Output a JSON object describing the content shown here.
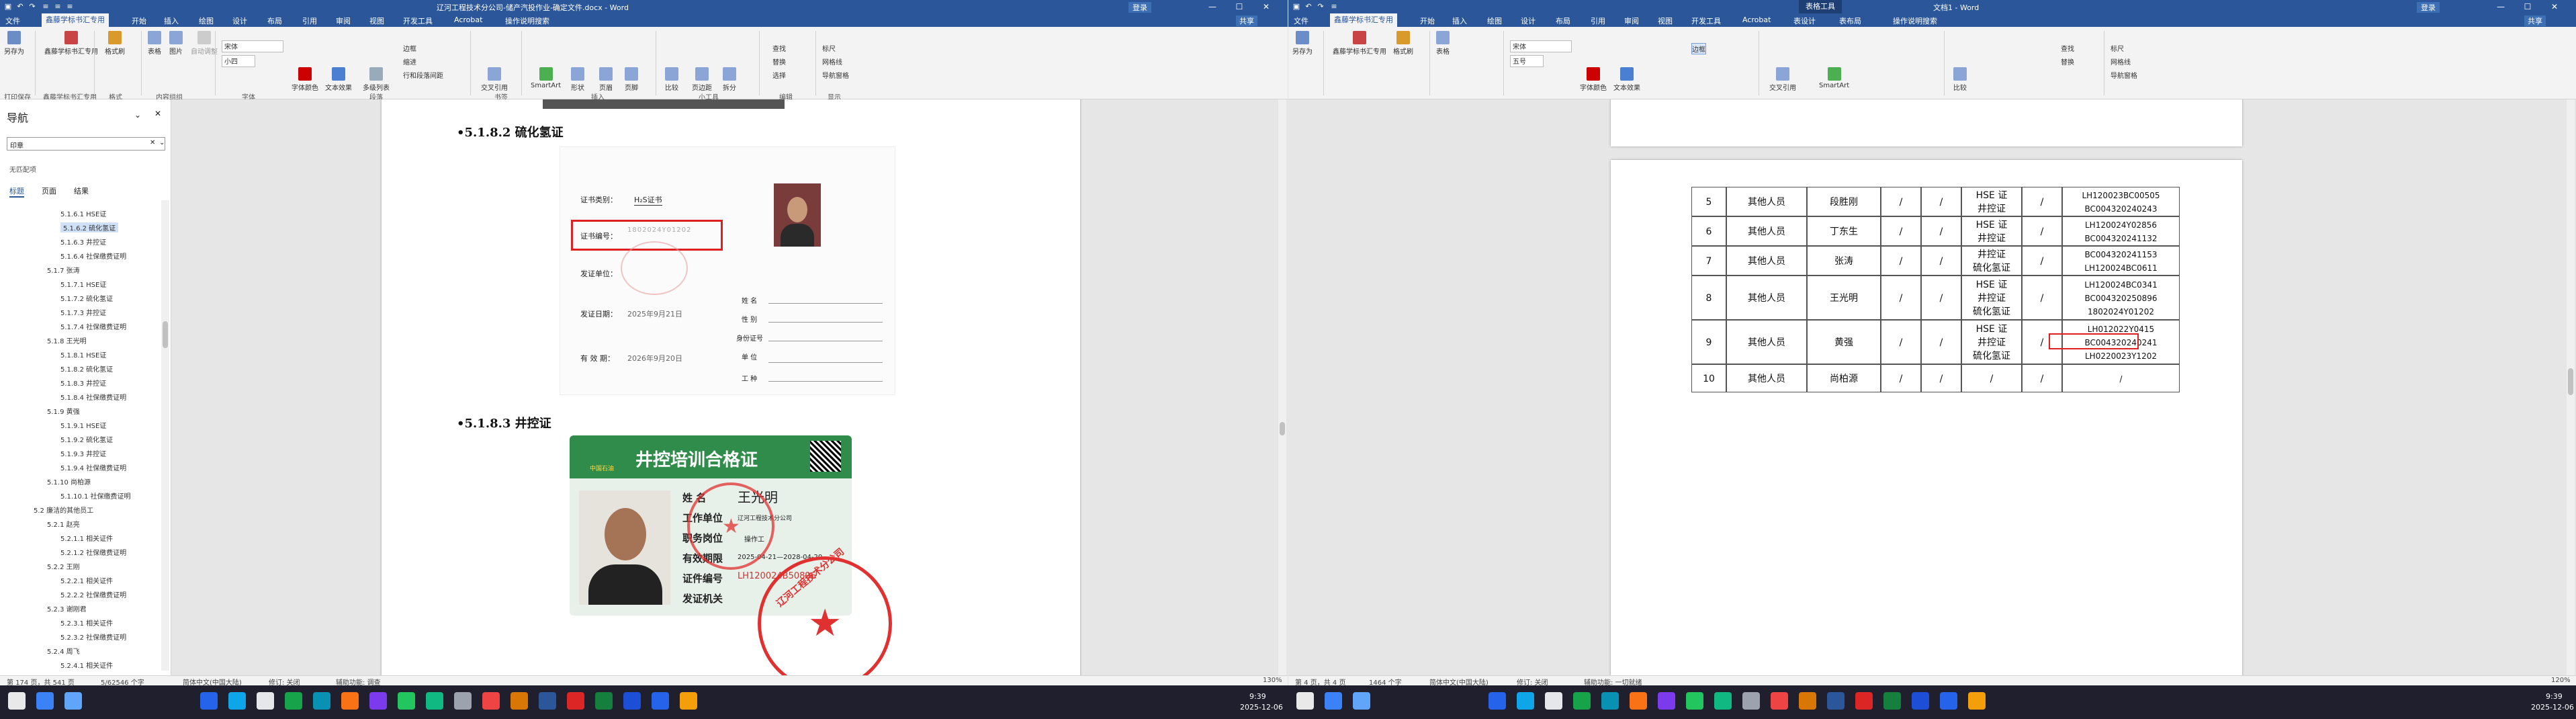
{
  "left": {
    "title": "辽河工程技术分公司-储产汽投作业-确定文件.docx - Word",
    "share": "共享",
    "sign_in": "登录",
    "tabs": [
      "文件",
      "鑫藤学标书汇专用",
      "开始",
      "插入",
      "绘图",
      "设计",
      "布局",
      "引用",
      "审阅",
      "视图",
      "开发工具",
      "Acrobat",
      "操作说明搜索"
    ],
    "ribbon": {
      "save_as": "另存为",
      "print_save": "打印保存",
      "xintan": "鑫藤学标书汇专用",
      "format_painter": "格式刷",
      "table": "表格",
      "picture": "图片",
      "auto_fit": "自动调整",
      "font": "宋体",
      "size": "小四",
      "font_color": "字体颜色",
      "text_effect": "文本效果",
      "multi_level": "多级列表",
      "border": "边框",
      "indent": "缩进",
      "line_spacing": "行和段落间距",
      "cross_ref": "交叉引用",
      "smartart": "SmartArt",
      "shape": "形状",
      "page": "页眉",
      "footer": "页脚",
      "compare": "比较",
      "page_break": "页边距",
      "split": "拆分",
      "find": "查找",
      "replace": "替换",
      "select": "选择",
      "ruler": "标尺",
      "grid": "网格线",
      "nav": "导航窗格",
      "groups": [
        "打印保存",
        "鑫藤学标书汇专用",
        "格式",
        "内容组组",
        "字体",
        "字体组",
        "段落",
        "书签",
        "插入",
        "小工具",
        "编辑",
        "显示"
      ]
    },
    "nav": {
      "title": "导航",
      "search": "印章",
      "no_match": "无匹配项",
      "tabs": [
        "标题",
        "页面",
        "结果"
      ],
      "items": [
        "5.1.6.1 HSE证",
        "5.1.6.2 硫化氢证",
        "5.1.6.3 井控证",
        "5.1.6.4 社保缴费证明",
        "5.1.7 张涛",
        "5.1.7.1 HSE证",
        "5.1.7.2 硫化氢证",
        "5.1.7.3 井控证",
        "5.1.7.4 社保缴费证明",
        "5.1.8 王光明",
        "5.1.8.1 HSE证",
        "5.1.8.2 硫化氢证",
        "5.1.8.3 井控证",
        "5.1.8.4 社保缴费证明",
        "5.1.9 黄强",
        "5.1.9.1 HSE证",
        "5.1.9.2 硫化氢证",
        "5.1.9.3 井控证",
        "5.1.9.4 社保缴费证明",
        "5.1.10 尚柏源",
        "5.1.10.1 社保缴费证明",
        "5.2 廉洁的其他员工",
        "5.2.1 赵亮",
        "5.2.1.1 相关证件",
        "5.2.1.2 社保缴费证明",
        "5.2.2 王刚",
        "5.2.2.1 相关证件",
        "5.2.2.2 社保缴费证明",
        "5.2.3 谢刚君",
        "5.2.3.1 相关证件",
        "5.2.3.2 社保缴费证明",
        "5.2.4 周飞",
        "5.2.4.1 相关证件"
      ]
    },
    "doc": {
      "h1": "•5.1.8.2  硫化氢证",
      "h2": "•5.1.8.3  井控证",
      "page_no": "174",
      "cert_type": "证书类别：",
      "cert_type_val": "H₂S证书",
      "cert_no": "证书编号：",
      "cert_no_val": "1802024Y01202",
      "issue_unit": "发证单位：",
      "issue_date": "发证日期：",
      "issue_date_val": "2025年9月21日",
      "valid": "有 效 期：",
      "valid_val": "2026年9月20日",
      "name": "姓 名",
      "sex": "性 别",
      "id": "身份证号",
      "unit": "单 位",
      "job": "工 种",
      "card_title": "井控培训合格证",
      "card_company": "中国石油",
      "card_name": "姓 名",
      "card_name_val": "王光明",
      "card_unit": "工作单位",
      "card_unit_val": "辽河工程技术分公司",
      "card_job": "职务岗位",
      "card_job_val": "操作工",
      "card_valid": "有效期限",
      "card_valid_val": "2025-04-21—2028-04-20",
      "card_no": "证件编号",
      "card_no_val": "LH120024B50896",
      "card_issuer": "发证机关",
      "seal": "辽河工程技术分公司"
    },
    "status": {
      "page": "第 174 页，共 541 页",
      "words": "5/62546 个字",
      "lang": "简体中文(中国大陆)",
      "track": "修订: 关闭",
      "access": "辅助功能: 调查",
      "zoom": "130%"
    }
  },
  "right": {
    "title": "文档1 - Word",
    "tool_tab": "表格工具",
    "share": "共享",
    "sign_in": "登录",
    "tabs": [
      "文件",
      "鑫藤学标书汇专用",
      "开始",
      "插入",
      "绘图",
      "设计",
      "布局",
      "引用",
      "审阅",
      "视图",
      "开发工具",
      "Acrobat",
      "表设计",
      "表布局",
      "操作说明搜索"
    ],
    "ribbon": {
      "font": "宋体",
      "size": "五号"
    },
    "table": [
      [
        "5",
        "其他人员",
        "段胜刚",
        "/",
        "/",
        "HSE 证\n井控证",
        "/",
        "LH120023BC00505\nBC004320240243"
      ],
      [
        "6",
        "其他人员",
        "丁东生",
        "/",
        "/",
        "HSE 证\n井控证",
        "/",
        "LH120024Y02856\nBC004320241132"
      ],
      [
        "7",
        "其他人员",
        "张涛",
        "/",
        "/",
        "井控证\n硫化氢证",
        "/",
        "BC004320241153\nLH120024BC0611"
      ],
      [
        "8",
        "其他人员",
        "王光明",
        "/",
        "/",
        "HSE 证\n井控证\n硫化氢证",
        "/",
        "LH120024BC0341\nBC004320250896\n1802024Y01202"
      ],
      [
        "9",
        "其他人员",
        "黄强",
        "/",
        "/",
        "HSE 证\n井控证\n硫化氢证",
        "/",
        "LH012022Y0415\nBC004320240241\nLH0220023Y1202"
      ],
      [
        "10",
        "其他人员",
        "尚柏源",
        "/",
        "/",
        "/",
        "/",
        "/"
      ]
    ],
    "status": {
      "page": "第 4 页，共 4 页",
      "words": "1464 个字",
      "lang": "简体中文(中国大陆)",
      "track": "修订: 关闭",
      "access": "辅助功能: 一切就绪",
      "zoom": "120%"
    }
  },
  "taskbar": {
    "clock1": "9:39",
    "date1": "2025-12-06",
    "clock2": "9:39",
    "date2": "2025-12-06"
  }
}
